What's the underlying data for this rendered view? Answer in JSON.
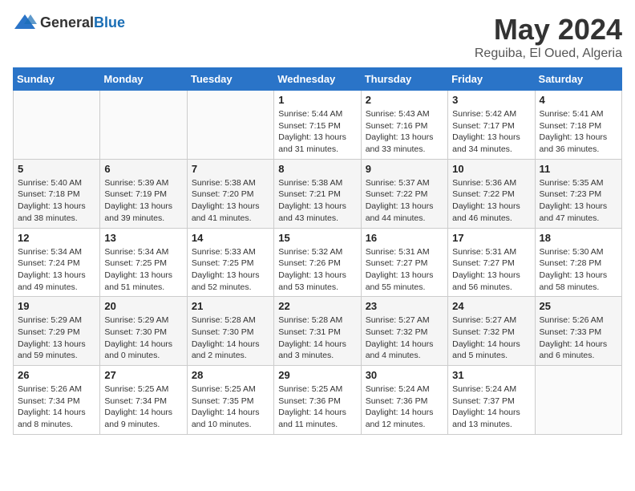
{
  "header": {
    "logo_general": "General",
    "logo_blue": "Blue",
    "month_year": "May 2024",
    "location": "Reguiba, El Oued, Algeria"
  },
  "weekdays": [
    "Sunday",
    "Monday",
    "Tuesday",
    "Wednesday",
    "Thursday",
    "Friday",
    "Saturday"
  ],
  "weeks": [
    [
      {
        "day": "",
        "info": ""
      },
      {
        "day": "",
        "info": ""
      },
      {
        "day": "",
        "info": ""
      },
      {
        "day": "1",
        "info": "Sunrise: 5:44 AM\nSunset: 7:15 PM\nDaylight: 13 hours\nand 31 minutes."
      },
      {
        "day": "2",
        "info": "Sunrise: 5:43 AM\nSunset: 7:16 PM\nDaylight: 13 hours\nand 33 minutes."
      },
      {
        "day": "3",
        "info": "Sunrise: 5:42 AM\nSunset: 7:17 PM\nDaylight: 13 hours\nand 34 minutes."
      },
      {
        "day": "4",
        "info": "Sunrise: 5:41 AM\nSunset: 7:18 PM\nDaylight: 13 hours\nand 36 minutes."
      }
    ],
    [
      {
        "day": "5",
        "info": "Sunrise: 5:40 AM\nSunset: 7:18 PM\nDaylight: 13 hours\nand 38 minutes."
      },
      {
        "day": "6",
        "info": "Sunrise: 5:39 AM\nSunset: 7:19 PM\nDaylight: 13 hours\nand 39 minutes."
      },
      {
        "day": "7",
        "info": "Sunrise: 5:38 AM\nSunset: 7:20 PM\nDaylight: 13 hours\nand 41 minutes."
      },
      {
        "day": "8",
        "info": "Sunrise: 5:38 AM\nSunset: 7:21 PM\nDaylight: 13 hours\nand 43 minutes."
      },
      {
        "day": "9",
        "info": "Sunrise: 5:37 AM\nSunset: 7:22 PM\nDaylight: 13 hours\nand 44 minutes."
      },
      {
        "day": "10",
        "info": "Sunrise: 5:36 AM\nSunset: 7:22 PM\nDaylight: 13 hours\nand 46 minutes."
      },
      {
        "day": "11",
        "info": "Sunrise: 5:35 AM\nSunset: 7:23 PM\nDaylight: 13 hours\nand 47 minutes."
      }
    ],
    [
      {
        "day": "12",
        "info": "Sunrise: 5:34 AM\nSunset: 7:24 PM\nDaylight: 13 hours\nand 49 minutes."
      },
      {
        "day": "13",
        "info": "Sunrise: 5:34 AM\nSunset: 7:25 PM\nDaylight: 13 hours\nand 51 minutes."
      },
      {
        "day": "14",
        "info": "Sunrise: 5:33 AM\nSunset: 7:25 PM\nDaylight: 13 hours\nand 52 minutes."
      },
      {
        "day": "15",
        "info": "Sunrise: 5:32 AM\nSunset: 7:26 PM\nDaylight: 13 hours\nand 53 minutes."
      },
      {
        "day": "16",
        "info": "Sunrise: 5:31 AM\nSunset: 7:27 PM\nDaylight: 13 hours\nand 55 minutes."
      },
      {
        "day": "17",
        "info": "Sunrise: 5:31 AM\nSunset: 7:27 PM\nDaylight: 13 hours\nand 56 minutes."
      },
      {
        "day": "18",
        "info": "Sunrise: 5:30 AM\nSunset: 7:28 PM\nDaylight: 13 hours\nand 58 minutes."
      }
    ],
    [
      {
        "day": "19",
        "info": "Sunrise: 5:29 AM\nSunset: 7:29 PM\nDaylight: 13 hours\nand 59 minutes."
      },
      {
        "day": "20",
        "info": "Sunrise: 5:29 AM\nSunset: 7:30 PM\nDaylight: 14 hours\nand 0 minutes."
      },
      {
        "day": "21",
        "info": "Sunrise: 5:28 AM\nSunset: 7:30 PM\nDaylight: 14 hours\nand 2 minutes."
      },
      {
        "day": "22",
        "info": "Sunrise: 5:28 AM\nSunset: 7:31 PM\nDaylight: 14 hours\nand 3 minutes."
      },
      {
        "day": "23",
        "info": "Sunrise: 5:27 AM\nSunset: 7:32 PM\nDaylight: 14 hours\nand 4 minutes."
      },
      {
        "day": "24",
        "info": "Sunrise: 5:27 AM\nSunset: 7:32 PM\nDaylight: 14 hours\nand 5 minutes."
      },
      {
        "day": "25",
        "info": "Sunrise: 5:26 AM\nSunset: 7:33 PM\nDaylight: 14 hours\nand 6 minutes."
      }
    ],
    [
      {
        "day": "26",
        "info": "Sunrise: 5:26 AM\nSunset: 7:34 PM\nDaylight: 14 hours\nand 8 minutes."
      },
      {
        "day": "27",
        "info": "Sunrise: 5:25 AM\nSunset: 7:34 PM\nDaylight: 14 hours\nand 9 minutes."
      },
      {
        "day": "28",
        "info": "Sunrise: 5:25 AM\nSunset: 7:35 PM\nDaylight: 14 hours\nand 10 minutes."
      },
      {
        "day": "29",
        "info": "Sunrise: 5:25 AM\nSunset: 7:36 PM\nDaylight: 14 hours\nand 11 minutes."
      },
      {
        "day": "30",
        "info": "Sunrise: 5:24 AM\nSunset: 7:36 PM\nDaylight: 14 hours\nand 12 minutes."
      },
      {
        "day": "31",
        "info": "Sunrise: 5:24 AM\nSunset: 7:37 PM\nDaylight: 14 hours\nand 13 minutes."
      },
      {
        "day": "",
        "info": ""
      }
    ]
  ]
}
